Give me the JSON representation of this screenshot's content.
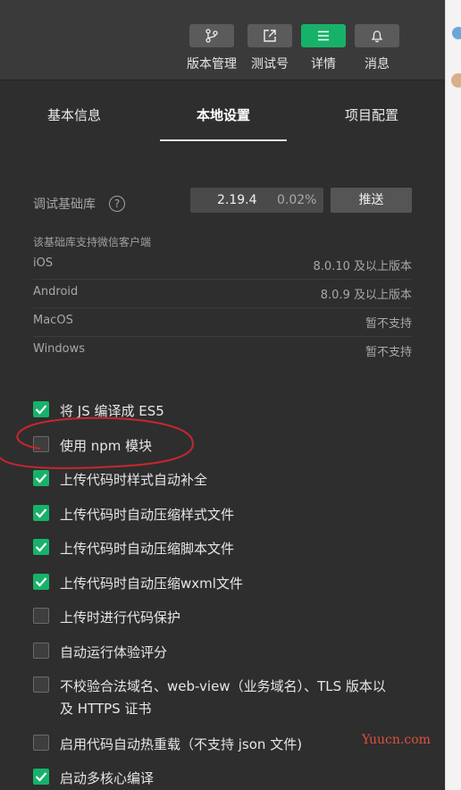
{
  "toolbar": {
    "buttons": [
      {
        "label": "版本管理",
        "icon": "branch-icon"
      },
      {
        "label": "测试号",
        "icon": "external-link-icon"
      },
      {
        "label": "详情",
        "icon": "menu-icon"
      },
      {
        "label": "消息",
        "icon": "bell-icon"
      }
    ],
    "active_color": "#17b26a"
  },
  "tabs": [
    "基本信息",
    "本地设置",
    "项目配置"
  ],
  "active_tab": "本地设置",
  "base_library": {
    "label": "调试基础库",
    "version": "2.19.4",
    "percent": "0.02%",
    "push_label": "推送"
  },
  "support": {
    "title": "该基础库支持微信客户端",
    "rows": [
      {
        "name": "iOS",
        "value": "8.0.10 及以上版本"
      },
      {
        "name": "Android",
        "value": "8.0.9 及以上版本"
      },
      {
        "name": "MacOS",
        "value": "暂不支持"
      },
      {
        "name": "Windows",
        "value": "暂不支持"
      }
    ]
  },
  "options": [
    {
      "label": "将 JS 编译成 ES5",
      "checked": true
    },
    {
      "label": "使用 npm 模块",
      "checked": false
    },
    {
      "label": "上传代码时样式自动补全",
      "checked": true
    },
    {
      "label": "上传代码时自动压缩样式文件",
      "checked": true
    },
    {
      "label": "上传代码时自动压缩脚本文件",
      "checked": true
    },
    {
      "label": "上传代码时自动压缩wxml文件",
      "checked": true
    },
    {
      "label": "上传时进行代码保护",
      "checked": false
    },
    {
      "label": "自动运行体验评分",
      "checked": false
    },
    {
      "label": "不校验合法域名、web-view（业务域名）、TLS 版本以及 HTTPS 证书",
      "checked": false
    },
    {
      "label": "启用代码自动热重载（不支持 json 文件)",
      "checked": false
    },
    {
      "label": "启动多核心编译",
      "checked": true
    }
  ],
  "watermark": "Yuucn.com"
}
